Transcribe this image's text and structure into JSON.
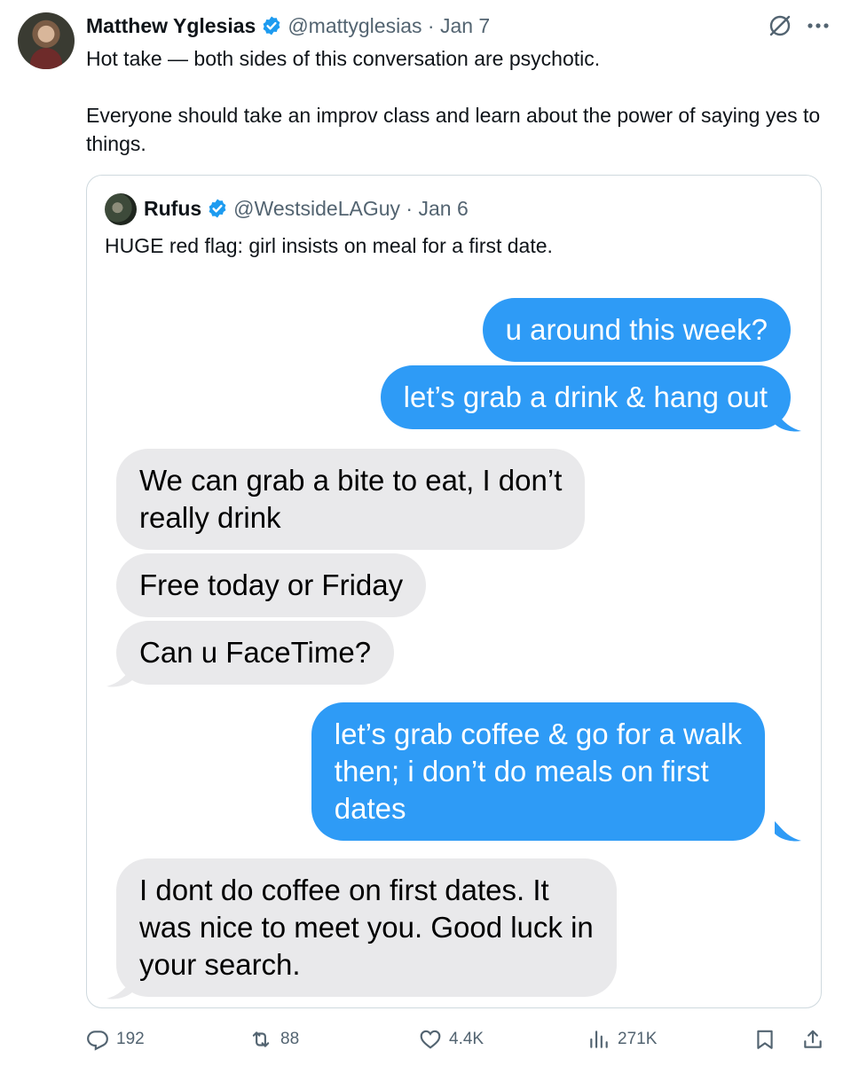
{
  "tweet": {
    "author_name": "Matthew Yglesias",
    "author_handle": "@mattyglesias",
    "separator": " · ",
    "date": "Jan 7",
    "text_lines": [
      "Hot take — both sides of this conversation are psychotic.",
      "Everyone should take an improv class and learn about the power of saying yes to things."
    ]
  },
  "quote": {
    "author_name": "Rufus",
    "author_handle": "@WestsideLAGuy",
    "separator": " · ",
    "date": "Jan 6",
    "text": "HUGE red flag: girl insists on meal for a first date.",
    "messages": [
      {
        "side": "out",
        "lines": [
          "u around this week?"
        ]
      },
      {
        "side": "out",
        "lines": [
          "let’s grab a drink & hang out"
        ]
      },
      {
        "side": "in",
        "lines": [
          "We can grab a bite to eat, I don’t",
          "really drink"
        ]
      },
      {
        "side": "in",
        "lines": [
          "Free today or Friday"
        ]
      },
      {
        "side": "in",
        "lines": [
          "Can u FaceTime?"
        ]
      },
      {
        "side": "out",
        "lines": [
          "let’s grab coffee & go for a walk",
          "then; i don’t do meals on first",
          "dates"
        ]
      },
      {
        "side": "in",
        "lines": [
          "I dont do coffee on first dates. It",
          "was nice to meet you. Good luck in",
          "your search."
        ]
      }
    ]
  },
  "actions": {
    "replies": "192",
    "reposts": "88",
    "likes": "4.4K",
    "views": "271K"
  },
  "colors": {
    "accent": "#1d9bf0",
    "imessage_blue": "#2e9bf6",
    "imessage_gray": "#e9e9eb",
    "secondary_text": "#536471"
  },
  "icons": {
    "verified": "verified-badge-icon",
    "grok": "grok-icon",
    "more": "more-icon",
    "reply": "reply-icon",
    "repost": "repost-icon",
    "like": "heart-icon",
    "views": "views-icon",
    "bookmark": "bookmark-icon",
    "share": "share-icon"
  }
}
